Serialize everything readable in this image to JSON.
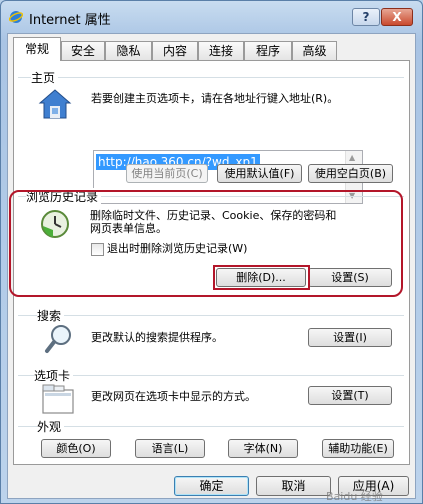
{
  "window": {
    "title": "Internet 属性",
    "help_label": "?",
    "close_label": "X"
  },
  "tabs": [
    "常规",
    "安全",
    "隐私",
    "内容",
    "连接",
    "程序",
    "高级"
  ],
  "home": {
    "group_title": "主页",
    "description": "若要创建主页选项卡，请在各地址行键入地址(R)。",
    "url": "http://hao.360.cn/?wd_xp1",
    "use_current": "使用当前页(C)",
    "use_default": "使用默认值(F)",
    "use_blank": "使用空白页(B)"
  },
  "history": {
    "group_title": "浏览历史记录",
    "description": "删除临时文件、历史记录、Cookie、保存的密码和网页表单信息。",
    "checkbox_label": "退出时删除浏览历史记录(W)",
    "checkbox_checked": false,
    "delete_button": "删除(D)...",
    "settings_button": "设置(S)"
  },
  "search": {
    "group_title": "搜索",
    "description": "更改默认的搜索提供程序。",
    "settings_button": "设置(I)"
  },
  "tabs_group": {
    "group_title": "选项卡",
    "description": "更改网页在选项卡中显示的方式。",
    "settings_button": "设置(T)"
  },
  "appearance": {
    "group_title": "外观",
    "colors": "颜色(O)",
    "languages": "语言(L)",
    "fonts": "字体(N)",
    "accessibility": "辅助功能(E)"
  },
  "footer": {
    "ok": "确定",
    "cancel": "取消",
    "apply": "应用(A)"
  },
  "watermark": "Baidu 经验",
  "colors": {
    "highlight": "#3399ff",
    "annotation": "#b3162a"
  }
}
